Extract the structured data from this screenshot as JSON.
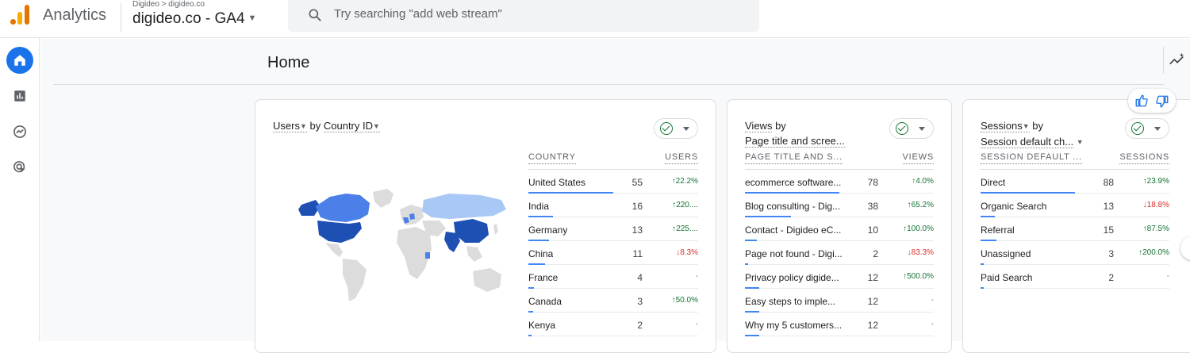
{
  "app": {
    "name": "Analytics",
    "breadcrumb": "Digideo > digideo.co",
    "property": "digideo.co - GA4",
    "search_placeholder": "Try searching \"add web stream\""
  },
  "page": {
    "title": "Home"
  },
  "cards": [
    {
      "title_metric": "Users",
      "title_by": "by",
      "title_dim": "Country ID",
      "col_dim": "COUNTRY",
      "col_metric": "USERS",
      "rows": [
        {
          "label": "United States",
          "value": "55",
          "change": "22.2%",
          "dir": "up",
          "bar": 1.0
        },
        {
          "label": "India",
          "value": "16",
          "change": "220....",
          "dir": "up",
          "bar": 0.29
        },
        {
          "label": "Germany",
          "value": "13",
          "change": "225....",
          "dir": "up",
          "bar": 0.24
        },
        {
          "label": "China",
          "value": "11",
          "change": "8.3%",
          "dir": "down",
          "bar": 0.2
        },
        {
          "label": "France",
          "value": "4",
          "change": "-",
          "dir": "na",
          "bar": 0.07
        },
        {
          "label": "Canada",
          "value": "3",
          "change": "50.0%",
          "dir": "up",
          "bar": 0.055
        },
        {
          "label": "Kenya",
          "value": "2",
          "change": "-",
          "dir": "na",
          "bar": 0.036
        }
      ]
    },
    {
      "title_metric": "Views",
      "title_by": "by",
      "title_dim": "Page title and scree...",
      "col_dim": "PAGE TITLE AND S...",
      "col_metric": "VIEWS",
      "rows": [
        {
          "label": "ecommerce software...",
          "value": "78",
          "change": "4.0%",
          "dir": "up",
          "bar": 1.0
        },
        {
          "label": "Blog consulting - Dig...",
          "value": "38",
          "change": "65.2%",
          "dir": "up",
          "bar": 0.49
        },
        {
          "label": "Contact - Digideo eC...",
          "value": "10",
          "change": "100.0%",
          "dir": "up",
          "bar": 0.13
        },
        {
          "label": "Page not found - Digi...",
          "value": "2",
          "change": "83.3%",
          "dir": "down",
          "bar": 0.03
        },
        {
          "label": "Privacy policy digide...",
          "value": "12",
          "change": "500.0%",
          "dir": "up",
          "bar": 0.15
        },
        {
          "label": "Easy steps to imple...",
          "value": "12",
          "change": "-",
          "dir": "na",
          "bar": 0.15
        },
        {
          "label": "Why my 5 customers...",
          "value": "12",
          "change": "-",
          "dir": "na",
          "bar": 0.15
        }
      ]
    },
    {
      "title_metric": "Sessions",
      "title_by": "by",
      "title_dim": "Session default ch...",
      "col_dim": "SESSION DEFAULT ...",
      "col_metric": "SESSIONS",
      "rows": [
        {
          "label": "Direct",
          "value": "88",
          "change": "23.9%",
          "dir": "up",
          "bar": 1.0
        },
        {
          "label": "Organic Search",
          "value": "13",
          "change": "18.8%",
          "dir": "down",
          "bar": 0.15
        },
        {
          "label": "Referral",
          "value": "15",
          "change": "87.5%",
          "dir": "up",
          "bar": 0.17
        },
        {
          "label": "Unassigned",
          "value": "3",
          "change": "200.0%",
          "dir": "up",
          "bar": 0.034
        },
        {
          "label": "Paid Search",
          "value": "2",
          "change": "-",
          "dir": "na",
          "bar": 0.023
        }
      ]
    }
  ],
  "icons": {
    "logo": "analytics-logo-icon",
    "search": "search-icon",
    "nav": [
      "home-icon",
      "reports-icon",
      "explore-icon",
      "advertising-icon"
    ],
    "insights": "insights-trend-icon",
    "feedback": [
      "thumbs-up-icon",
      "thumbs-down-icon"
    ]
  },
  "colors": {
    "accent": "#1a73e8",
    "bar": "#4285f4",
    "up": "#137333",
    "down": "#d93025",
    "map_high": "#1e50b4",
    "map_mid": "#4a80e8",
    "map_low": "#aac8f5",
    "map_none": "#dcdcdc"
  }
}
